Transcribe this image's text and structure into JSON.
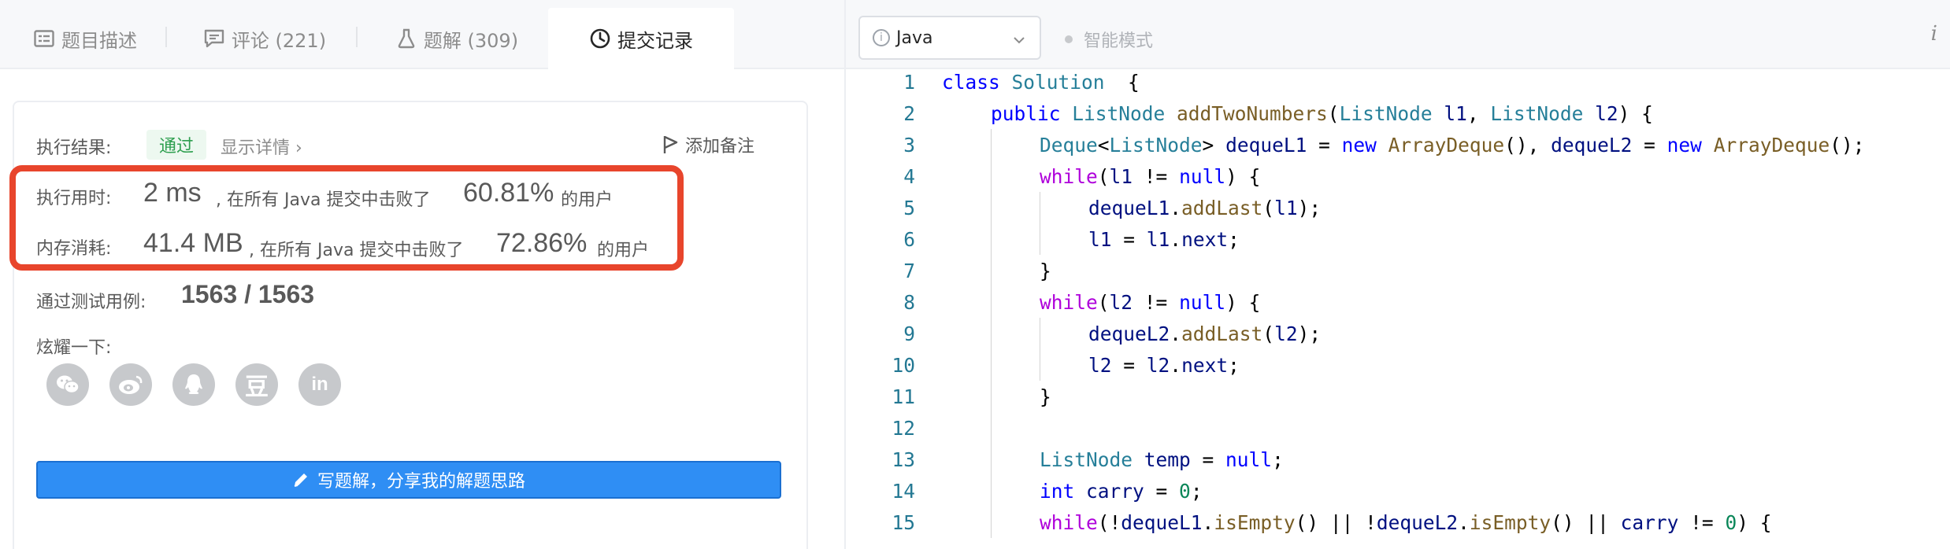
{
  "tabs": [
    {
      "label": "题目描述",
      "icon": "description-icon"
    },
    {
      "label": "评论 (221)",
      "icon": "comment-icon"
    },
    {
      "label": "题解 (309)",
      "icon": "flask-icon"
    },
    {
      "label": "提交记录",
      "icon": "clock-icon",
      "active": true
    }
  ],
  "result": {
    "label": "执行结果:",
    "status": "通过",
    "details_link": "显示详情 ›",
    "add_note": "添加备注",
    "runtime": {
      "label": "执行用时:",
      "value": "2 ms",
      "text1": ", 在所有 Java 提交中击败了",
      "percent": "60.81%",
      "text2": "的用户"
    },
    "memory": {
      "label": "内存消耗:",
      "value": "41.4 MB",
      "text1": ", 在所有 Java 提交中击败了",
      "percent": "72.86%",
      "text2": "的用户"
    },
    "tests": {
      "label": "通过测试用例:",
      "value": "1563 / 1563"
    },
    "share_label": "炫耀一下:",
    "share_icons": [
      "wechat-icon",
      "weibo-icon",
      "qq-icon",
      "douban-icon",
      "linkedin-icon"
    ],
    "write_button": "写题解，分享我的解题思路"
  },
  "editor": {
    "language": "Java",
    "smart_mode": "智能模式",
    "info_label": "i"
  },
  "colors": {
    "highlight": "#e8452c",
    "accent": "#2f8ef4",
    "success": "#2e9f4f"
  },
  "code_lines": [
    {
      "n": "1",
      "indent": 0,
      "tokens": [
        [
          "kw",
          "class "
        ],
        [
          "ty",
          "Solution"
        ],
        [
          "",
          "  {"
        ]
      ]
    },
    {
      "n": "2",
      "indent": 1,
      "tokens": [
        [
          "kw",
          "public "
        ],
        [
          "ty",
          "ListNode "
        ],
        [
          "fn",
          "addTwoNumbers"
        ],
        [
          "",
          "("
        ],
        [
          "ty",
          "ListNode "
        ],
        [
          "vr",
          "l1"
        ],
        [
          "",
          ", "
        ],
        [
          "ty",
          "ListNode "
        ],
        [
          "vr",
          "l2"
        ],
        [
          "",
          ") {"
        ]
      ]
    },
    {
      "n": "3",
      "indent": 2,
      "tokens": [
        [
          "ty",
          "Deque"
        ],
        [
          "",
          "<"
        ],
        [
          "ty",
          "ListNode"
        ],
        [
          "",
          "> "
        ],
        [
          "vr",
          "dequeL1"
        ],
        [
          "",
          " = "
        ],
        [
          "kw",
          "new "
        ],
        [
          "fn",
          "ArrayDeque"
        ],
        [
          "",
          "(), "
        ],
        [
          "vr",
          "dequeL2"
        ],
        [
          "",
          " = "
        ],
        [
          "kw",
          "new "
        ],
        [
          "fn",
          "ArrayDeque"
        ],
        [
          "",
          "();"
        ]
      ]
    },
    {
      "n": "4",
      "indent": 2,
      "tokens": [
        [
          "kw2",
          "while"
        ],
        [
          "",
          "("
        ],
        [
          "vr",
          "l1"
        ],
        [
          "",
          " != "
        ],
        [
          "kw",
          "null"
        ],
        [
          "",
          ") {"
        ]
      ]
    },
    {
      "n": "5",
      "indent": 3,
      "tokens": [
        [
          "vr",
          "dequeL1"
        ],
        [
          "",
          "."
        ],
        [
          "fn",
          "addLast"
        ],
        [
          "",
          "("
        ],
        [
          "vr",
          "l1"
        ],
        [
          "",
          ");"
        ]
      ]
    },
    {
      "n": "6",
      "indent": 3,
      "tokens": [
        [
          "vr",
          "l1"
        ],
        [
          "",
          " = "
        ],
        [
          "vr",
          "l1"
        ],
        [
          "",
          "."
        ],
        [
          "vr",
          "next"
        ],
        [
          "",
          ";"
        ]
      ]
    },
    {
      "n": "7",
      "indent": 2,
      "tokens": [
        [
          "",
          "}"
        ]
      ]
    },
    {
      "n": "8",
      "indent": 2,
      "tokens": [
        [
          "kw2",
          "while"
        ],
        [
          "",
          "("
        ],
        [
          "vr",
          "l2"
        ],
        [
          "",
          " != "
        ],
        [
          "kw",
          "null"
        ],
        [
          "",
          ") {"
        ]
      ]
    },
    {
      "n": "9",
      "indent": 3,
      "tokens": [
        [
          "vr",
          "dequeL2"
        ],
        [
          "",
          "."
        ],
        [
          "fn",
          "addLast"
        ],
        [
          "",
          "("
        ],
        [
          "vr",
          "l2"
        ],
        [
          "",
          ");"
        ]
      ]
    },
    {
      "n": "10",
      "indent": 3,
      "tokens": [
        [
          "vr",
          "l2"
        ],
        [
          "",
          " = "
        ],
        [
          "vr",
          "l2"
        ],
        [
          "",
          "."
        ],
        [
          "vr",
          "next"
        ],
        [
          "",
          ";"
        ]
      ]
    },
    {
      "n": "11",
      "indent": 2,
      "tokens": [
        [
          "",
          "}"
        ]
      ]
    },
    {
      "n": "12",
      "indent": 2,
      "tokens": []
    },
    {
      "n": "13",
      "indent": 2,
      "tokens": [
        [
          "ty",
          "ListNode "
        ],
        [
          "vr",
          "temp"
        ],
        [
          "",
          " = "
        ],
        [
          "kw",
          "null"
        ],
        [
          "",
          ";"
        ]
      ]
    },
    {
      "n": "14",
      "indent": 2,
      "tokens": [
        [
          "kw",
          "int "
        ],
        [
          "vr",
          "carry"
        ],
        [
          "",
          " = "
        ],
        [
          "nm",
          "0"
        ],
        [
          "",
          ";"
        ]
      ]
    },
    {
      "n": "15",
      "indent": 2,
      "tokens": [
        [
          "kw2",
          "while"
        ],
        [
          "",
          "(!"
        ],
        [
          "vr",
          "dequeL1"
        ],
        [
          "",
          "."
        ],
        [
          "fn",
          "isEmpty"
        ],
        [
          "",
          "() || !"
        ],
        [
          "vr",
          "dequeL2"
        ],
        [
          "",
          "."
        ],
        [
          "fn",
          "isEmpty"
        ],
        [
          "",
          "() || "
        ],
        [
          "vr",
          "carry"
        ],
        [
          "",
          " != "
        ],
        [
          "nm",
          "0"
        ],
        [
          "",
          ") {"
        ]
      ]
    }
  ]
}
